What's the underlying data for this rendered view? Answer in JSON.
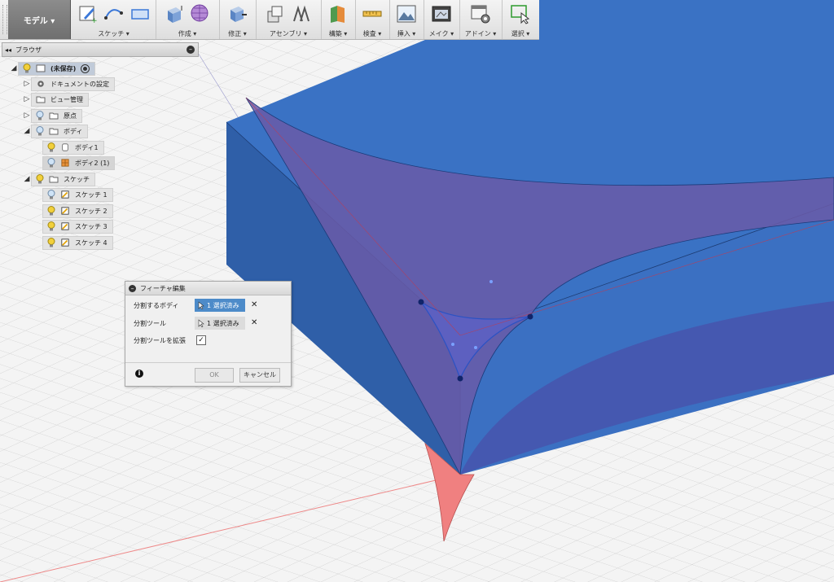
{
  "toolbar": {
    "mode": "モデル ▾",
    "groups": [
      {
        "label": "スケッチ ▾",
        "icons": [
          "create-sketch-icon",
          "spline-icon",
          "rectangle-icon"
        ]
      },
      {
        "label": "作成 ▾",
        "icons": [
          "extrude-box-icon",
          "form-grid-icon"
        ]
      },
      {
        "label": "修正 ▾",
        "icons": [
          "press-pull-icon"
        ]
      },
      {
        "label": "アセンブリ ▾",
        "icons": [
          "new-component-icon",
          "joint-icon"
        ]
      },
      {
        "label": "構築 ▾",
        "icons": [
          "construction-plane-icon"
        ]
      },
      {
        "label": "検査 ▾",
        "icons": [
          "measure-icon"
        ]
      },
      {
        "label": "挿入 ▾",
        "icons": [
          "insert-image-icon"
        ]
      },
      {
        "label": "メイク ▾",
        "icons": [
          "make-3dprint-icon"
        ]
      },
      {
        "label": "アドイン ▾",
        "icons": [
          "scripts-addins-icon"
        ]
      },
      {
        "label": "選択 ▾",
        "icons": [
          "select-window-icon"
        ]
      }
    ]
  },
  "browser": {
    "title": "ブラウザ",
    "root": "(未保存)",
    "items": [
      {
        "label": "ドキュメントの設定"
      },
      {
        "label": "ビュー管理"
      },
      {
        "label": "原点"
      },
      {
        "label": "ボディ"
      },
      {
        "label": "ボディ1"
      },
      {
        "label": "ボディ2 (1)"
      },
      {
        "label": "スケッチ"
      },
      {
        "label": "スケッチ 1"
      },
      {
        "label": "スケッチ 2"
      },
      {
        "label": "スケッチ 3"
      },
      {
        "label": "スケッチ 4"
      }
    ]
  },
  "dialog": {
    "title": "フィーチャ編集",
    "body_label": "分割するボディ",
    "body_value": "1 選択済み",
    "tool_label": "分割ツール",
    "tool_value": "1 選択済み",
    "extend_label": "分割ツールを拡張",
    "extend_checked": "✓",
    "ok": "OK",
    "cancel": "キャンセル",
    "info": "i"
  },
  "colors": {
    "body_blue": "#2f68bf",
    "surface_purple": "#6a5aa8",
    "cusp_red": "#f08080",
    "active_select": "#4d8bc9"
  }
}
